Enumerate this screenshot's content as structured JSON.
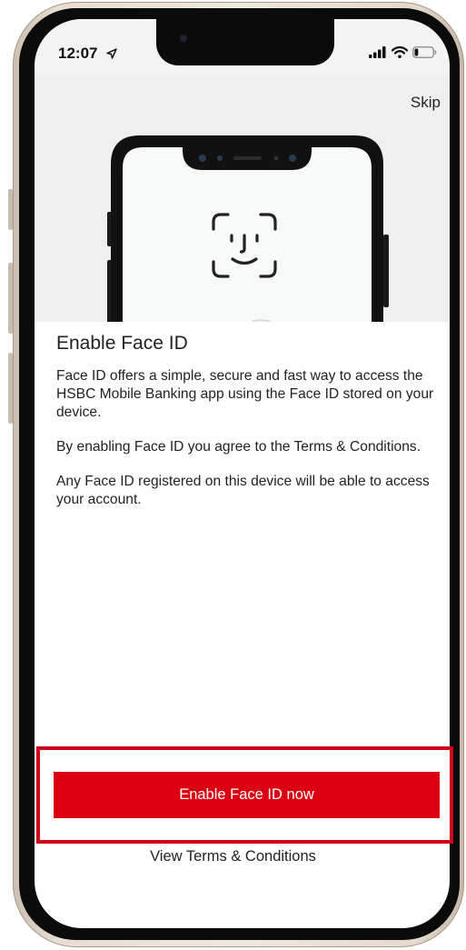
{
  "status_bar": {
    "time": "12:07",
    "location_icon": "location-arrow-icon",
    "signal_icon": "cellular-signal-icon",
    "wifi_icon": "wifi-icon",
    "battery_icon": "battery-low-icon",
    "battery_level": 0.2
  },
  "header": {
    "skip_label": "Skip"
  },
  "hero": {
    "illustration_icon": "face-id-icon"
  },
  "main": {
    "title": "Enable Face ID",
    "paragraphs": [
      "Face ID offers a simple, secure and fast way to access the HSBC Mobile Banking app using the Face ID stored on your device.",
      "By enabling Face ID you agree to the Terms & Conditions.",
      "Any  Face ID registered on this device will be able to access your account."
    ]
  },
  "actions": {
    "enable_label": "Enable Face ID now",
    "terms_label": "View Terms & Conditions"
  },
  "colors": {
    "brand_red": "#db0011",
    "highlight_red": "#d0021b"
  }
}
